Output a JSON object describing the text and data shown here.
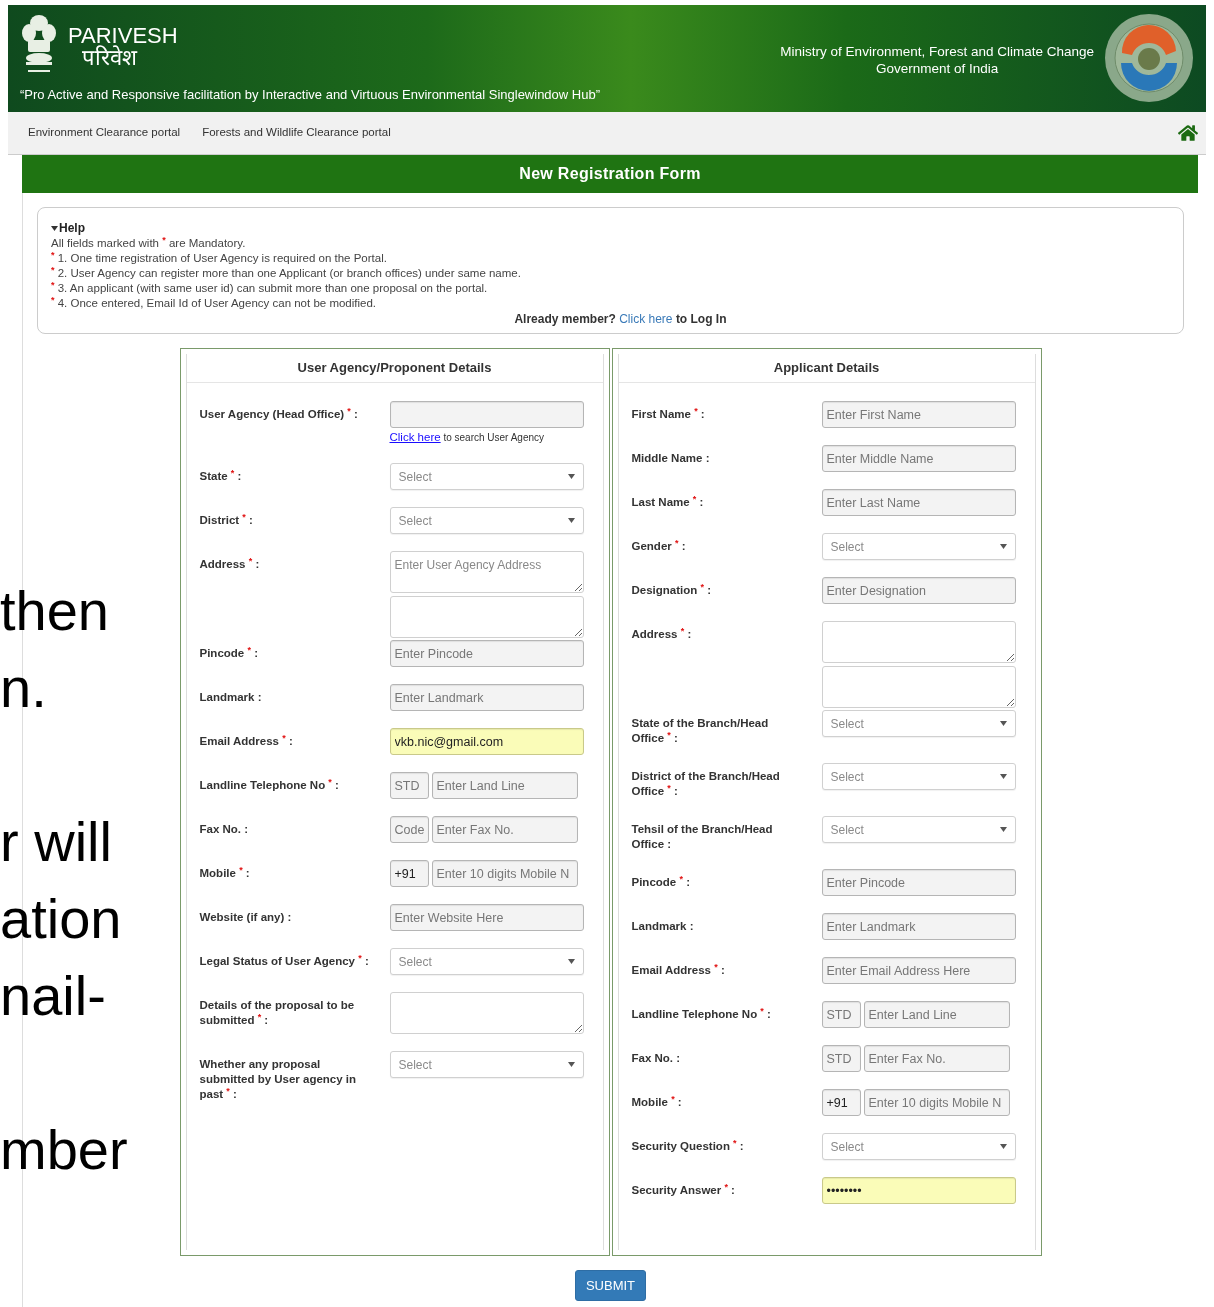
{
  "header": {
    "title": "PARIVESH",
    "title_hindi": "परिवेश",
    "tagline": "“Pro Active and Responsive facilitation by Interactive and Virtuous Environmental Singlewindow Hub”",
    "ministry": "Ministry of Environment, Forest and Climate Change",
    "government": "Government of India"
  },
  "nav": {
    "links": [
      "Environment Clearance portal",
      "Forests and Wildlife Clearance portal"
    ]
  },
  "form_title": "New Registration Form",
  "help": {
    "title": "Help",
    "expanded": true,
    "intro": "All fields marked with $^{*}$ are Mandatory.",
    "items": [
      "$^{*}$ 1. One time registration of User Agency is required on the Portal.",
      "$^{*}$ 2. User Agency can register more than one Applicant (or branch offices) under same name.",
      "$^{*}$ 3. An applicant (with same user id) can submit more than one proposal on the portal.",
      "$^{*}$ 4. Once entered, Email Id of User Agency can not be modified."
    ],
    "login": {
      "before": "Already member?",
      "link": "Click here",
      "after": "to Log In"
    }
  },
  "panels": [
    {
      "title": "User Agency/Proponent Details",
      "fields": [
        {
          "kind": "text",
          "label": "User Agency (Head Office) $^{*}$ :",
          "hint": {
            "link": "Click here",
            "text": "to search User Agency"
          }
        },
        {
          "kind": "select",
          "label": "State $^{*}$ :",
          "placeholder": "Select"
        },
        {
          "kind": "select",
          "label": "District $^{*}$ :",
          "placeholder": "Select"
        },
        {
          "kind": "address",
          "label": "Address $^{*}$ :",
          "placeholder": "Enter User Agency Address"
        },
        {
          "kind": "text",
          "label": "Pincode $^{*}$ :",
          "placeholder": "Enter Pincode"
        },
        {
          "kind": "text",
          "label": "Landmark :",
          "placeholder": "Enter Landmark"
        },
        {
          "kind": "text",
          "label": "Email Address $^{*}$ :",
          "value": "vkb.nic@gmail.com",
          "autofill": true
        },
        {
          "kind": "pair",
          "label": "Landline Telephone No $^{*}$ :",
          "prefix": {
            "placeholder": "STD"
          },
          "placeholder": "Enter Land Line"
        },
        {
          "kind": "pair",
          "label": "Fax No. :",
          "prefix": {
            "placeholder": "Code"
          },
          "placeholder": "Enter Fax No."
        },
        {
          "kind": "pair",
          "label": "Mobile $^{*}$ :",
          "prefix": {
            "value": "+91"
          },
          "placeholder": "Enter 10 digits Mobile N"
        },
        {
          "kind": "text",
          "label": "Website (if any) :",
          "placeholder": "Enter Website Here"
        },
        {
          "kind": "select",
          "label": "Legal Status of User Agency $^{*}$ :",
          "placeholder": "Select"
        },
        {
          "kind": "textarea",
          "label": "Details of the proposal to be submitted $^{*}$ :"
        },
        {
          "kind": "select",
          "label": "Whether any proposal submitted by User agency in past $^{*}$ :",
          "placeholder": "Select"
        }
      ]
    },
    {
      "title": "Applicant Details",
      "fields": [
        {
          "kind": "text",
          "label": "First Name $^{*}$ :",
          "placeholder": "Enter First Name"
        },
        {
          "kind": "text",
          "label": "Middle Name :",
          "placeholder": "Enter Middle Name"
        },
        {
          "kind": "text",
          "label": "Last Name $^{*}$ :",
          "placeholder": "Enter Last Name"
        },
        {
          "kind": "select",
          "label": "Gender $^{*}$ :",
          "placeholder": "Select"
        },
        {
          "kind": "text",
          "label": "Designation $^{*}$ :",
          "placeholder": "Enter Designation"
        },
        {
          "kind": "address",
          "label": "Address $^{*}$ :"
        },
        {
          "kind": "select",
          "label": "State of the Branch/Head Office $^{*}$ :",
          "placeholder": "Select"
        },
        {
          "kind": "select",
          "label": "District of the Branch/Head Office $^{*}$ :",
          "placeholder": "Select"
        },
        {
          "kind": "select",
          "label": "Tehsil of the Branch/Head Office :",
          "placeholder": "Select"
        },
        {
          "kind": "text",
          "label": "Pincode $^{*}$ :",
          "placeholder": "Enter Pincode"
        },
        {
          "kind": "text",
          "label": "Landmark :",
          "placeholder": "Enter Landmark"
        },
        {
          "kind": "text",
          "label": "Email Address $^{*}$ :",
          "placeholder": "Enter Email Address Here"
        },
        {
          "kind": "pair",
          "label": "Landline Telephone No $^{*}$ :",
          "prefix": {
            "placeholder": "STD"
          },
          "placeholder": "Enter Land Line"
        },
        {
          "kind": "pair",
          "label": "Fax No. :",
          "prefix": {
            "placeholder": "STD"
          },
          "placeholder": "Enter Fax No."
        },
        {
          "kind": "pair",
          "label": "Mobile $^{*}$ :",
          "prefix": {
            "value": "+91"
          },
          "placeholder": "Enter 10 digits Mobile N"
        },
        {
          "kind": "select",
          "label": "Security Question $^{*}$ :",
          "placeholder": "Select"
        },
        {
          "kind": "text",
          "label": "Security Answer $^{*}$ :",
          "value": "••••••••",
          "autofill": true
        }
      ]
    }
  ],
  "submit": "SUBMIT",
  "slide_text_blocks": [
    [
      "then",
      "n."
    ],
    [
      "r will",
      "ation",
      "nail-"
    ],
    [
      "mber"
    ]
  ]
}
